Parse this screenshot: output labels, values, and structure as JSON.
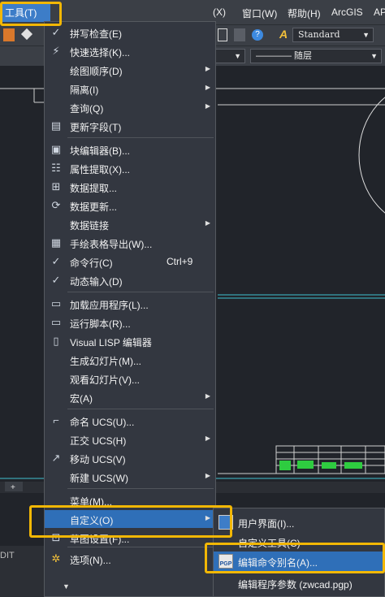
{
  "menubar": {
    "tools": "工具(T)",
    "items": [
      "(X)",
      "窗口(W)",
      "帮助(H)",
      "ArcGIS",
      "AP"
    ]
  },
  "toolbar": {
    "text_style": "Standard",
    "layer": "———— 随层"
  },
  "main_menu": {
    "items": [
      {
        "label": "拼写检查(E)",
        "icon": "spell-check-icon"
      },
      {
        "label": "快速选择(K)...",
        "icon": "quick-select-icon"
      },
      {
        "label": "绘图顺序(D)",
        "icon": "none",
        "submenu": true
      },
      {
        "label": "隔离(I)",
        "icon": "none",
        "submenu": true
      },
      {
        "label": "查询(Q)",
        "icon": "none",
        "submenu": true
      },
      {
        "label": "更新字段(T)",
        "icon": "update-field-icon"
      },
      {
        "label": "块编辑器(B)...",
        "icon": "block-editor-icon"
      },
      {
        "label": "属性提取(X)...",
        "icon": "attribute-extract-icon"
      },
      {
        "label": "数据提取...",
        "icon": "data-extract-icon"
      },
      {
        "label": "数据更新...",
        "icon": "data-update-icon"
      },
      {
        "label": "数据链接",
        "icon": "none",
        "submenu": true
      },
      {
        "label": "手绘表格导出(W)...",
        "icon": "table-export-icon"
      },
      {
        "label": "命令行(C)",
        "icon": "check-icon",
        "shortcut": "Ctrl+9"
      },
      {
        "label": "动态输入(D)",
        "icon": "check-icon"
      },
      {
        "label": "加载应用程序(L)...",
        "icon": "load-app-icon"
      },
      {
        "label": "运行脚本(R)...",
        "icon": "run-script-icon"
      },
      {
        "label": "Visual LISP 编辑器",
        "icon": "lisp-icon"
      },
      {
        "label": "生成幻灯片(M)...",
        "icon": "none"
      },
      {
        "label": "观看幻灯片(V)...",
        "icon": "none"
      },
      {
        "label": "宏(A)",
        "icon": "none",
        "submenu": true
      },
      {
        "label": "命名 UCS(U)...",
        "icon": "named-ucs-icon"
      },
      {
        "label": "正交 UCS(H)",
        "icon": "none",
        "submenu": true
      },
      {
        "label": "移动 UCS(V)",
        "icon": "move-ucs-icon"
      },
      {
        "label": "新建 UCS(W)",
        "icon": "none",
        "submenu": true
      },
      {
        "label": "菜单(M)...",
        "icon": "none"
      },
      {
        "label": "自定义(O)",
        "icon": "none",
        "submenu": true
      },
      {
        "label": "草图设置(F)...",
        "icon": "drafting-settings-icon"
      },
      {
        "label": "选项(N)...",
        "icon": "options-gear-icon"
      }
    ]
  },
  "sub_menu": {
    "items": [
      {
        "label": "用户界面(I)...",
        "icon": "user-interface-icon"
      },
      {
        "label": "自定义工具(C)",
        "icon": "none"
      },
      {
        "label": "编辑命令别名(A)...",
        "icon": "pgp-icon"
      },
      {
        "label": "编辑程序参数 (zwcad.pgp)",
        "icon": "none"
      }
    ]
  },
  "status": {
    "left_text": "DIT"
  },
  "colors": {
    "accent": "#2f6fb8",
    "highlight_box": "#f2b705",
    "menu_bg": "#333740"
  }
}
